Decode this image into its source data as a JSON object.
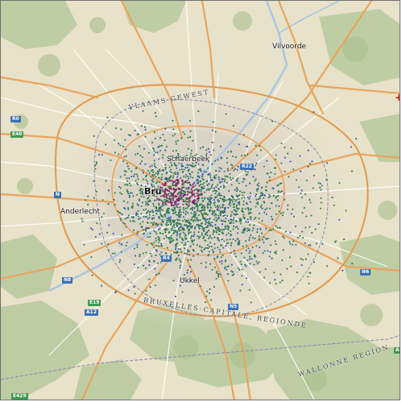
{
  "map": {
    "places": {
      "vilvoorde": "Vilvoorde",
      "schaerbeek": "Schaerbeek",
      "brussel": "Bru",
      "anderlecht": "Anderlecht",
      "ukkel": "Ukkel"
    },
    "regions": {
      "vlaams": "VLAAMS GEWEST",
      "bruxelles": "BRUXELLES-CAPITALE, REGIONDE",
      "wallonne": "WALLONNE REGION"
    },
    "shields": {
      "r0_left": "R0",
      "e40_left": "E40",
      "n_left": "N",
      "n8": "N8",
      "n6": "N6",
      "e19": "E19",
      "n5": "N5",
      "a12": "A12",
      "r22": "R22",
      "r4": "R4",
      "e429": "E429",
      "a201": "A201"
    },
    "marker_symbol": "+",
    "colors": {
      "land": "#e8e3cc",
      "forest": "#b9caa0",
      "road_major": "#e8a15a",
      "road_minor": "#ffffff",
      "water": "#a9c6e6",
      "point_green": "#2e7d46",
      "point_blue": "#3456a6",
      "point_magenta": "#8e1c6e"
    }
  }
}
